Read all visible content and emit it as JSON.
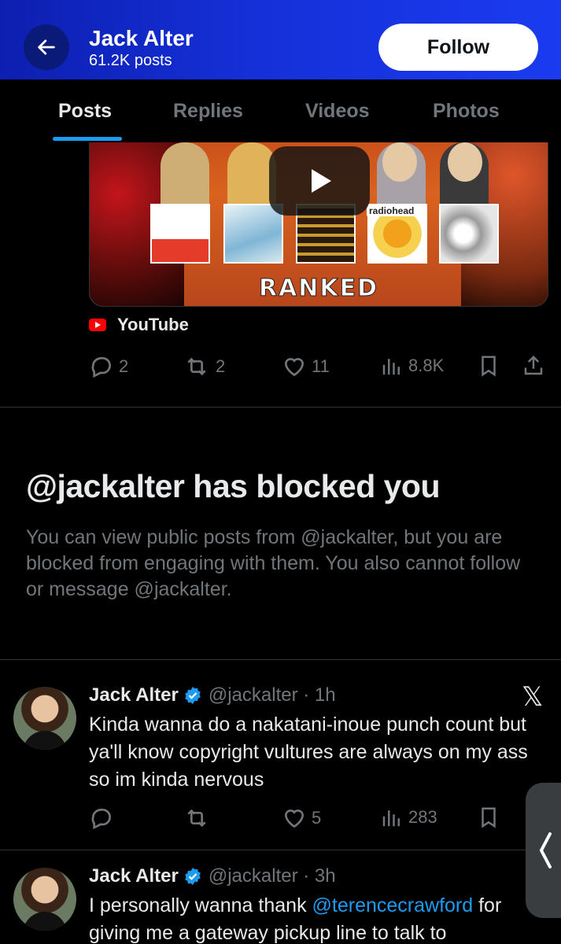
{
  "header": {
    "name": "Jack Alter",
    "post_count": "61.2K posts",
    "follow_label": "Follow"
  },
  "tabs": [
    {
      "label": "Posts",
      "active": true
    },
    {
      "label": "Replies",
      "active": false
    },
    {
      "label": "Videos",
      "active": false
    },
    {
      "label": "Photos",
      "active": false
    }
  ],
  "video_post": {
    "thumbnail_caption": "RANKED",
    "album_caption": "radiohead",
    "source_label": "YouTube",
    "actions": {
      "replies": "2",
      "reposts": "2",
      "likes": "11",
      "views": "8.8K"
    }
  },
  "blocked_notice": {
    "title": "@jackalter has blocked you",
    "body": "You can view public posts from @jackalter, but you are blocked from engaging with them. You also cannot follow or message @jackalter."
  },
  "posts": [
    {
      "name": "Jack Alter",
      "handle": "@jackalter · 1h",
      "text": "Kinda wanna do a nakatani-inoue punch count but ya'll know copyright vultures are always on my ass so im kinda nervous",
      "likes": "5",
      "views": "283"
    },
    {
      "name": "Jack Alter",
      "handle": "@jackalter · 3h",
      "text_before": "I personally wanna thank ",
      "mention": "@terencecrawford",
      "text_after": " for giving me a gateway pickup line to talk to"
    }
  ],
  "icons": {
    "back": "arrow-left-icon",
    "play": "play-icon",
    "reply": "reply-icon",
    "repost": "repost-icon",
    "like": "heart-icon",
    "views": "views-icon",
    "bookmark": "bookmark-icon",
    "share": "share-icon",
    "verified": "verified-badge-icon",
    "x_logo": "x-logo-icon"
  },
  "colors": {
    "header_blue": "#1530d8",
    "accent": "#1d9bf0",
    "muted": "#71767b",
    "youtube_red": "#ff0000"
  }
}
